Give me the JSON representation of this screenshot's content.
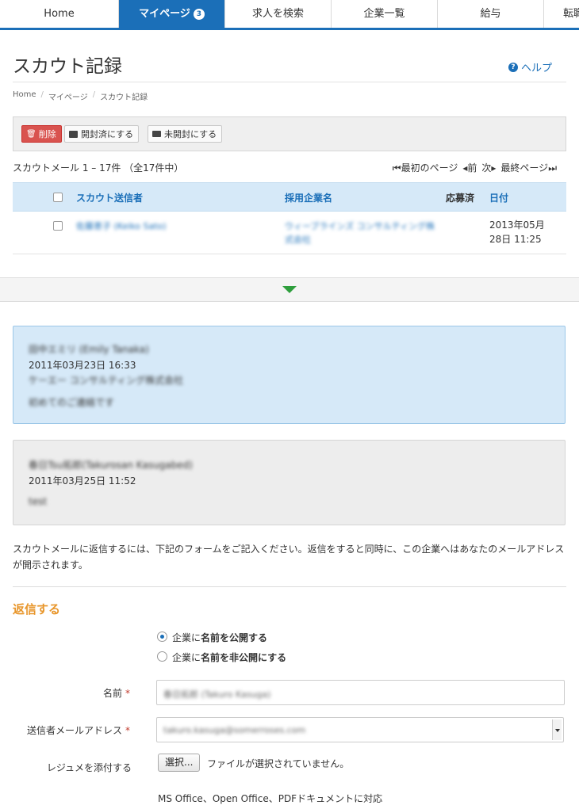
{
  "nav": {
    "tabs": [
      {
        "label": "Home",
        "active": false
      },
      {
        "label": "マイページ",
        "active": true,
        "badge": "3"
      },
      {
        "label": "求人を検索",
        "active": false
      },
      {
        "label": "企業一覧",
        "active": false
      },
      {
        "label": "給与",
        "active": false
      },
      {
        "label": "転職",
        "active": false
      }
    ]
  },
  "page": {
    "title": "スカウト記録",
    "help_label": "ヘルプ"
  },
  "breadcrumb": [
    "Home",
    "マイページ",
    "スカウト記録"
  ],
  "toolbar": {
    "delete_label": "削除",
    "mark_read_label": "開封済にする",
    "mark_unread_label": "未開封にする"
  },
  "list": {
    "count_text": "スカウトメール 1 – 17件 （全17件中）",
    "pager": {
      "first": "最初のページ",
      "prev": "前",
      "next": "次",
      "last": "最終ページ"
    },
    "columns": {
      "sender": "スカウト送信者",
      "company": "採用企業名",
      "applied": "応募済",
      "date": "日付"
    },
    "rows": [
      {
        "sender": "佐藤恵子 (Keiko Sato)",
        "company": "ウィーブラインズ コンサルティング株式会社",
        "date_line1": "2013年05月",
        "date_line2": "28日 11:25"
      }
    ]
  },
  "colors": {
    "primary": "#1b6fb8",
    "accent": "#e8962b",
    "danger": "#d9534f",
    "toggle": "#2e9e3c"
  },
  "thread": [
    {
      "sender": "田中エミリ (Emily Tanaka)",
      "date": "2011年03月23日 16:33",
      "company": "ケーエー コンサルティング株式会社",
      "body": "初めてのご連絡です"
    },
    {
      "sender": "春日Tsu拓郎(Takurosan Kasugabed)",
      "date": "2011年03月25日 11:52",
      "body": "test"
    }
  ],
  "notice": "スカウトメールに返信するには、下記のフォームをご記入ください。返信をすると同時に、この企業へはあなたのメールアドレスが開示されます。",
  "reply": {
    "title": "返信する",
    "radio_public_prefix": "企業に",
    "radio_public_bold": "名前を公開する",
    "radio_private_prefix": "企業に",
    "radio_private_bold": "名前を非公開にする",
    "name_label": "名前",
    "name_value": "春日拓郎 (Takuro Kasuga)",
    "email_label": "送信者メールアドレス",
    "email_value": "takuro.kasuga@somerroses.com",
    "resume_label": "レジュメを添付する",
    "file_button": "選択...",
    "file_status": "ファイルが選択されていません。",
    "file_hint": "MS Office、Open Office、PDFドキュメントに対応",
    "required_mark": "*"
  }
}
